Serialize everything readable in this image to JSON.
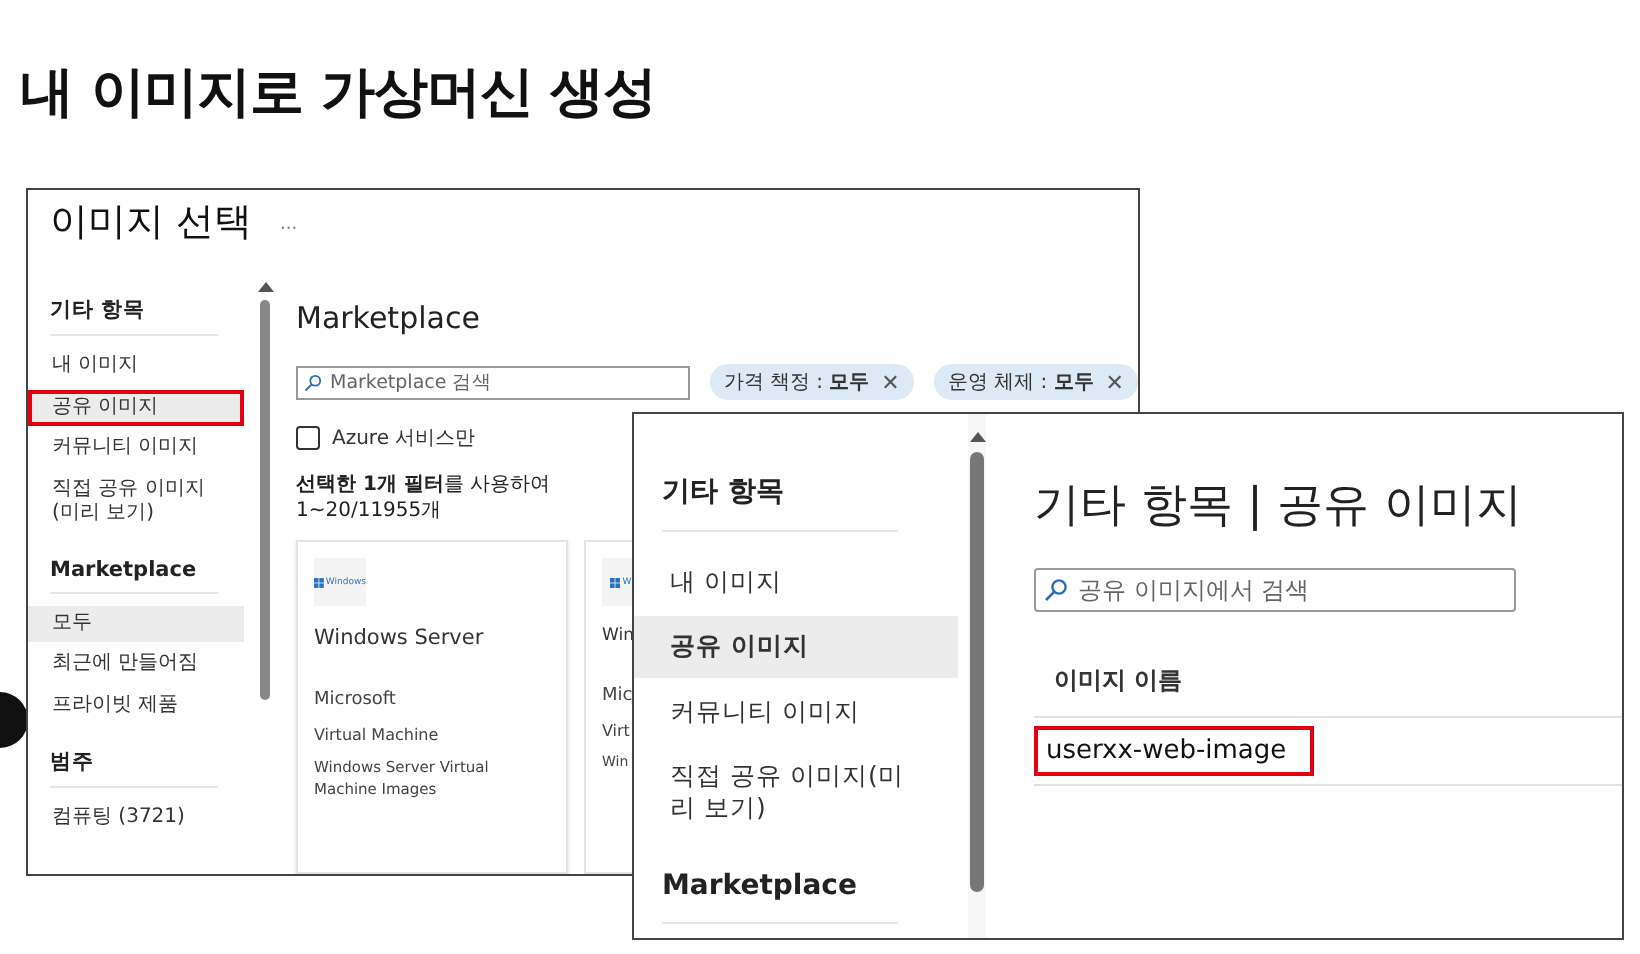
{
  "slide": {
    "title": "내 이미지로 가상머신 생성"
  },
  "selector_window": {
    "title": "이미지 선택",
    "more": "···",
    "sidebar": [
      {
        "heading": "기타 항목",
        "items": [
          {
            "label": "내 이미지",
            "selected": false,
            "marked": false
          },
          {
            "label": "공유 이미지",
            "selected": true,
            "marked": true
          },
          {
            "label": "커뮤니티 이미지",
            "selected": false,
            "marked": false
          },
          {
            "label": "직접 공유 이미지(미리 보기)",
            "selected": false,
            "marked": false
          }
        ]
      },
      {
        "heading": "Marketplace",
        "items": [
          {
            "label": "모두",
            "selected": true,
            "marked": false
          },
          {
            "label": "최근에 만들어짐",
            "selected": false,
            "marked": false
          },
          {
            "label": "프라이빗 제품",
            "selected": false,
            "marked": false
          }
        ]
      },
      {
        "heading": "범주",
        "items": [
          {
            "label": "컴퓨팅 (3721)",
            "selected": false,
            "marked": false
          }
        ]
      }
    ],
    "heading": "Marketplace",
    "search": {
      "placeholder": "Marketplace 검색"
    },
    "filters": [
      {
        "label": "가격 책정 : **모두**",
        "close": "✕"
      },
      {
        "label": "운영 체제 : **모두**",
        "close": "✕"
      }
    ],
    "checkbox": {
      "label": "Azure 서비스만",
      "checked": false
    },
    "result_text": "**선택한 1개 필터**를 사용하여 1~20/11955개",
    "cards": [
      {
        "kind": "full",
        "logo": "Windows",
        "title": "Windows Server",
        "publisher": "Microsoft",
        "type": "Virtual Machine",
        "description": "Windows Server Virtual Machine Images"
      },
      {
        "kind": "partial",
        "logo": "W",
        "title": "Win",
        "publisher": "Mic",
        "type": "Virt",
        "description": "Win"
      }
    ]
  },
  "shared_window": {
    "sidebar": [
      {
        "heading": "기타 항목",
        "items": [
          {
            "label": "내 이미지",
            "selected": false
          },
          {
            "label": "공유 이미지",
            "selected": true
          },
          {
            "label": "커뮤니티 이미지",
            "selected": false
          },
          {
            "label": "직접 공유 이미지(미리 보기)",
            "selected": false
          }
        ]
      },
      {
        "heading": "Marketplace"
      }
    ],
    "heading": "기타 항목 | 공유 이미지",
    "search": {
      "placeholder": "공유 이미지에서 검색"
    },
    "columns": [
      "이미지 이름"
    ],
    "rows": [
      {
        "name": "userxx-web-image",
        "marked": true
      }
    ]
  }
}
